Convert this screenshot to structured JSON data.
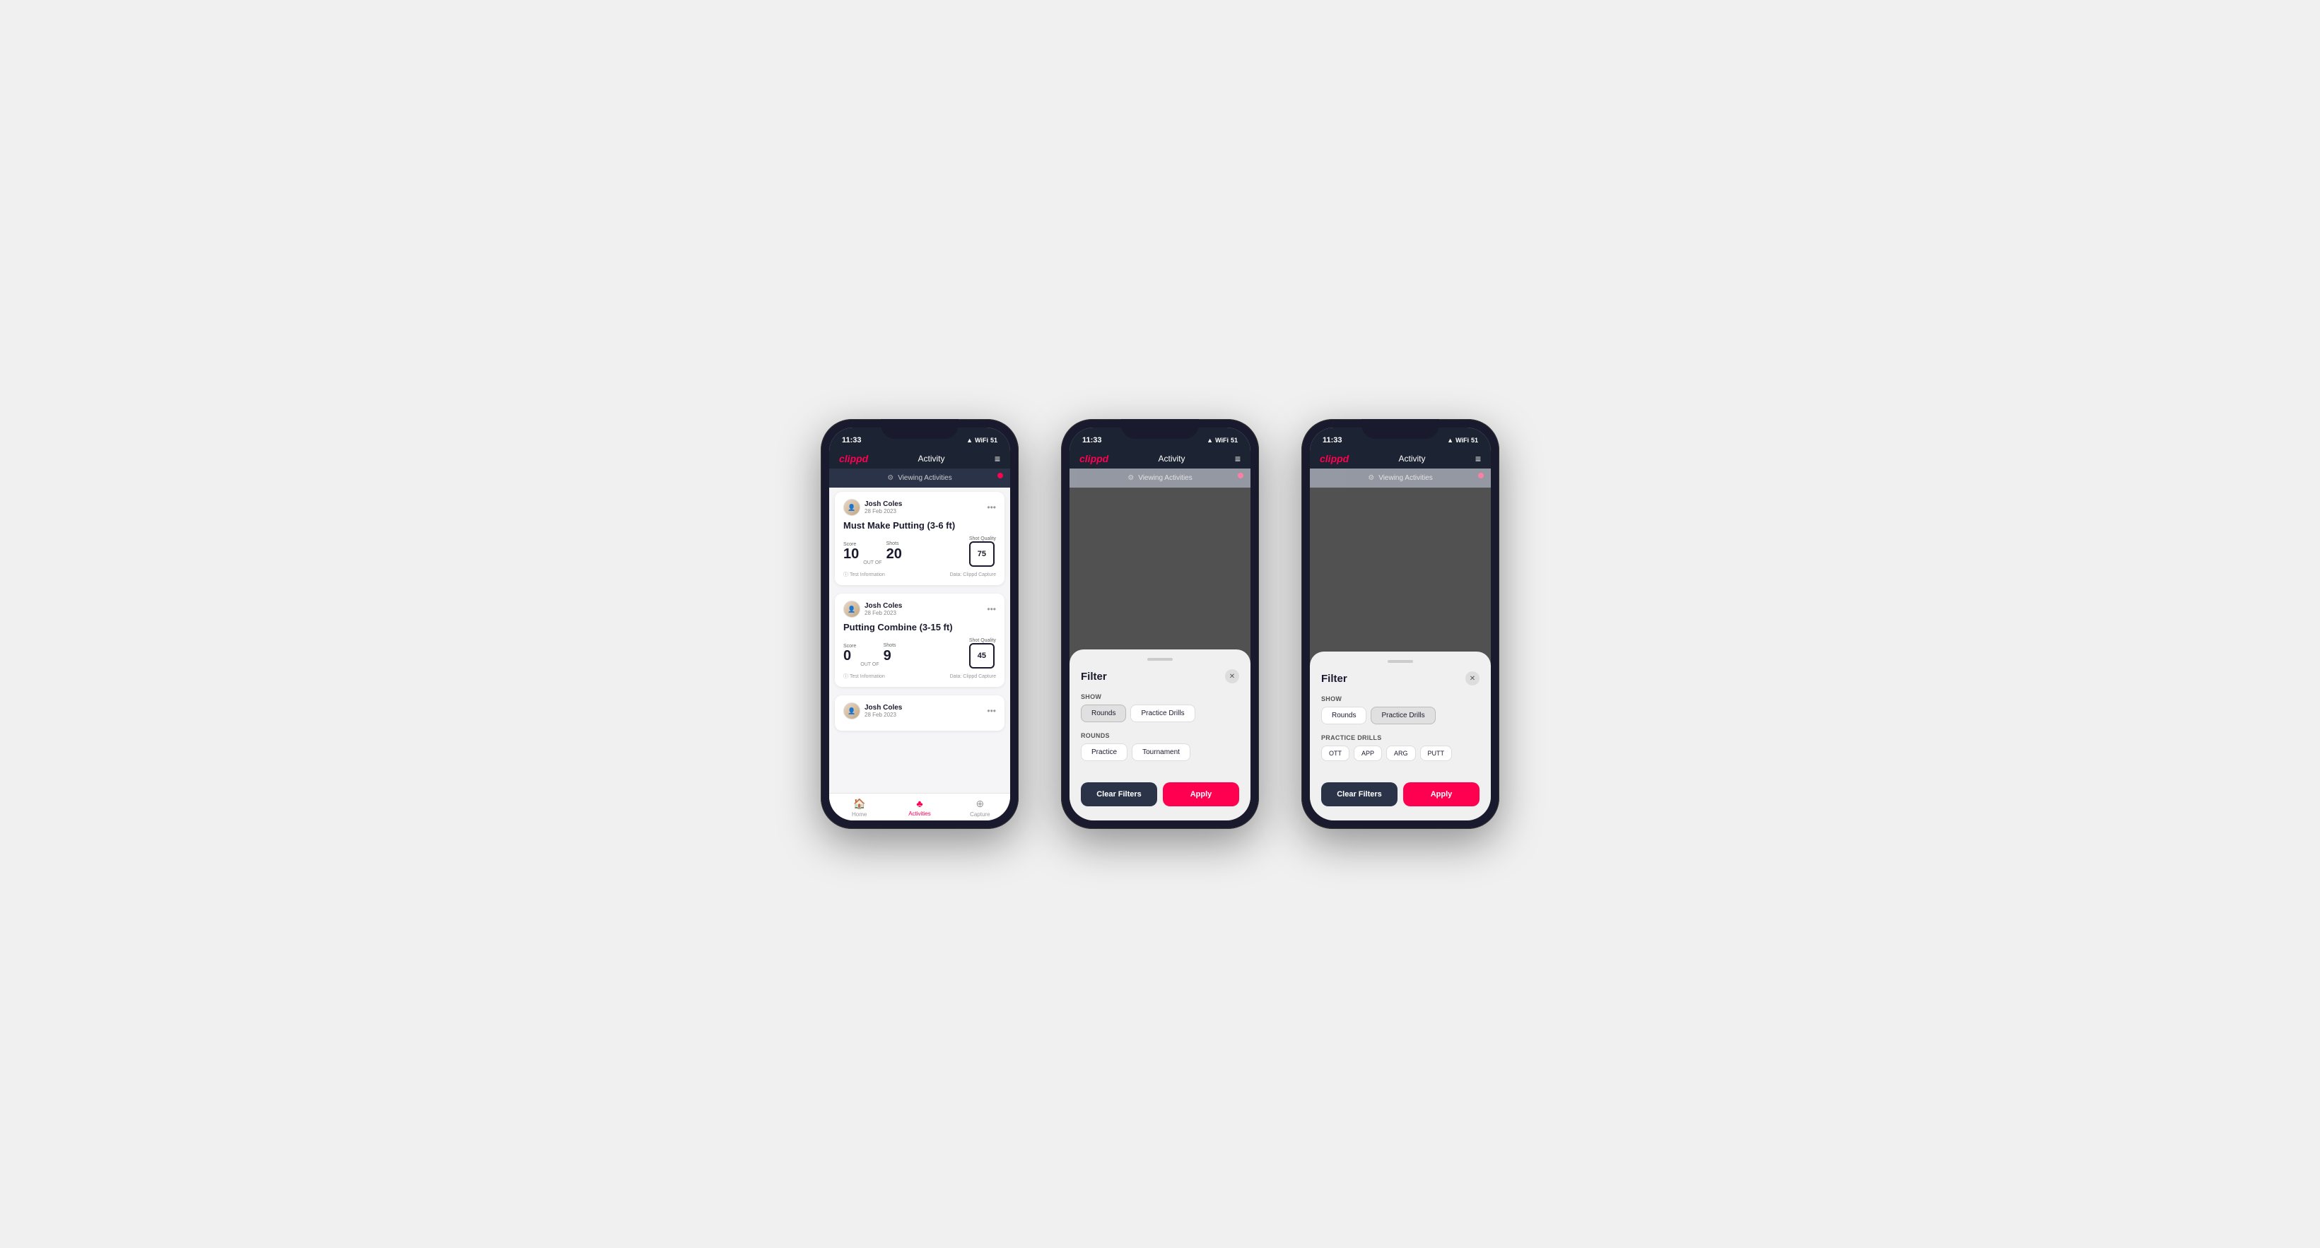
{
  "statusBar": {
    "time": "11:33",
    "icons": "▲ WiFi Bat"
  },
  "nav": {
    "logo": "clippd",
    "title": "Activity",
    "menu": "≡"
  },
  "viewingBanner": {
    "text": "Viewing Activities"
  },
  "phone1": {
    "cards": [
      {
        "userName": "Josh Coles",
        "userDate": "28 Feb 2023",
        "activityTitle": "Must Make Putting (3-6 ft)",
        "scoreLabel": "Score",
        "scoreValue": "10",
        "outOf": "OUT OF",
        "shotsLabel": "Shots",
        "shotsValue": "20",
        "shotQualityLabel": "Shot Quality",
        "shotQualityValue": "75",
        "testInfo": "Test Information",
        "dataSource": "Data: Clippd Capture"
      },
      {
        "userName": "Josh Coles",
        "userDate": "28 Feb 2023",
        "activityTitle": "Putting Combine (3-15 ft)",
        "scoreLabel": "Score",
        "scoreValue": "0",
        "outOf": "OUT OF",
        "shotsLabel": "Shots",
        "shotsValue": "9",
        "shotQualityLabel": "Shot Quality",
        "shotQualityValue": "45",
        "testInfo": "Test Information",
        "dataSource": "Data: Clippd Capture"
      },
      {
        "userName": "Josh Coles",
        "userDate": "28 Feb 2023",
        "activityTitle": "",
        "scoreLabel": "",
        "scoreValue": "",
        "outOf": "",
        "shotsLabel": "",
        "shotsValue": "",
        "shotQualityLabel": "",
        "shotQualityValue": "",
        "testInfo": "",
        "dataSource": ""
      }
    ],
    "bottomNav": [
      {
        "icon": "🏠",
        "label": "Home",
        "active": false
      },
      {
        "icon": "♣",
        "label": "Activities",
        "active": true
      },
      {
        "icon": "➕",
        "label": "Capture",
        "active": false
      }
    ]
  },
  "phone2": {
    "filter": {
      "title": "Filter",
      "showLabel": "Show",
      "showOptions": [
        {
          "label": "Rounds",
          "selected": true
        },
        {
          "label": "Practice Drills",
          "selected": false
        }
      ],
      "roundsLabel": "Rounds",
      "roundsOptions": [
        {
          "label": "Practice",
          "selected": false
        },
        {
          "label": "Tournament",
          "selected": false
        }
      ],
      "clearLabel": "Clear Filters",
      "applyLabel": "Apply"
    }
  },
  "phone3": {
    "filter": {
      "title": "Filter",
      "showLabel": "Show",
      "showOptions": [
        {
          "label": "Rounds",
          "selected": false
        },
        {
          "label": "Practice Drills",
          "selected": true
        }
      ],
      "practiceDrillsLabel": "Practice Drills",
      "drillOptions": [
        {
          "label": "OTT",
          "selected": false
        },
        {
          "label": "APP",
          "selected": false
        },
        {
          "label": "ARG",
          "selected": false
        },
        {
          "label": "PUTT",
          "selected": false
        }
      ],
      "clearLabel": "Clear Filters",
      "applyLabel": "Apply"
    }
  }
}
